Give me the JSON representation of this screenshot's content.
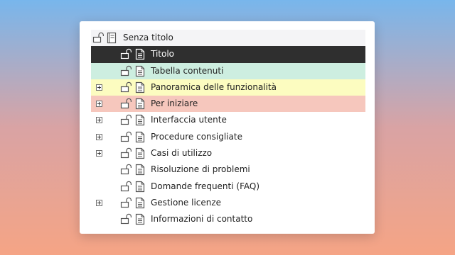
{
  "colors": {
    "selected_bg": "#2f2f2f",
    "green_highlight": "#cdeee0",
    "yellow_highlight": "#fcfcc0",
    "red_highlight": "#f6c7bd"
  },
  "tree": {
    "root": {
      "label": "Senza titolo",
      "icons": [
        "unlocked-lock-icon",
        "book-icon"
      ]
    },
    "items": [
      {
        "label": "Titolo",
        "expandable": false,
        "state": "selected"
      },
      {
        "label": "Tabella contenuti",
        "expandable": false,
        "state": "green"
      },
      {
        "label": "Panoramica delle funzionalità",
        "expandable": true,
        "state": "yellow"
      },
      {
        "label": "Per iniziare",
        "expandable": true,
        "state": "red"
      },
      {
        "label": "Interfaccia utente",
        "expandable": true,
        "state": ""
      },
      {
        "label": "Procedure consigliate",
        "expandable": true,
        "state": ""
      },
      {
        "label": "Casi di utilizzo",
        "expandable": true,
        "state": ""
      },
      {
        "label": "Risoluzione di problemi",
        "expandable": false,
        "state": ""
      },
      {
        "label": "Domande frequenti (FAQ)",
        "expandable": false,
        "state": ""
      },
      {
        "label": "Gestione licenze",
        "expandable": true,
        "state": ""
      },
      {
        "label": "Informazioni di contatto",
        "expandable": false,
        "state": ""
      }
    ]
  }
}
